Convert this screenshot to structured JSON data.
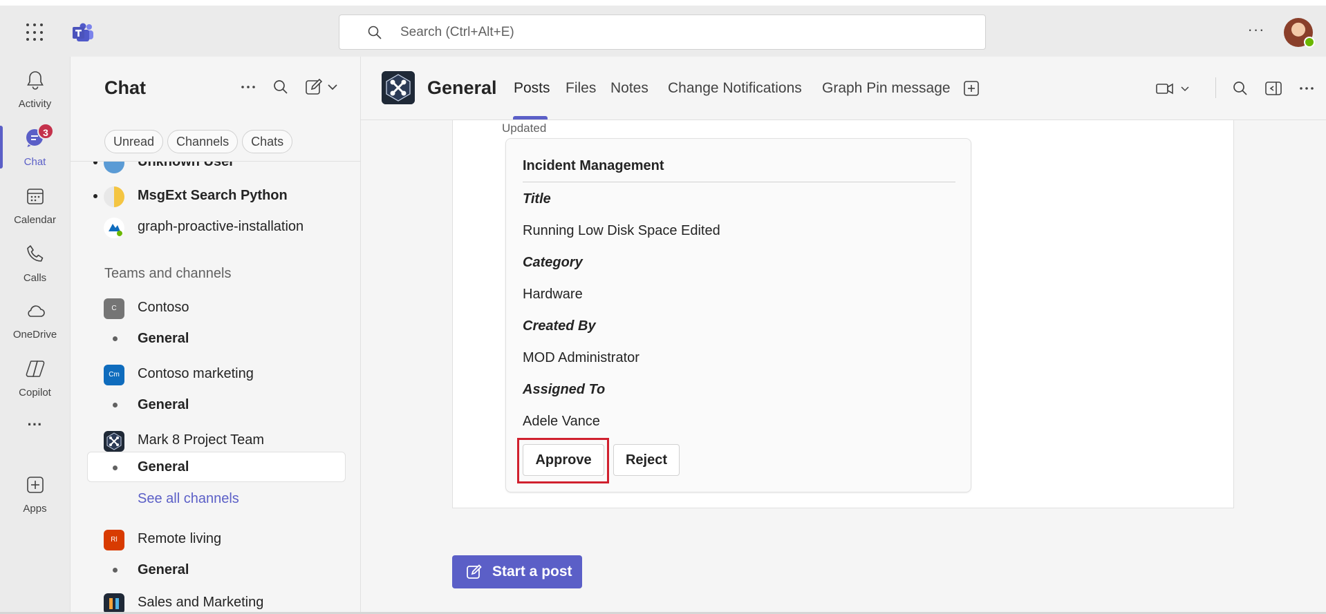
{
  "search": {
    "placeholder": "Search (Ctrl+Alt+E)"
  },
  "top": {
    "more": "···"
  },
  "rail": {
    "items": [
      {
        "label": "Activity",
        "icon": "bell-icon"
      },
      {
        "label": "Chat",
        "icon": "chat-icon",
        "badge": "3",
        "active": true
      },
      {
        "label": "Calendar",
        "icon": "calendar-icon"
      },
      {
        "label": "Calls",
        "icon": "phone-icon"
      },
      {
        "label": "OneDrive",
        "icon": "cloud-icon"
      },
      {
        "label": "Copilot",
        "icon": "copilot-icon"
      },
      {
        "label": "···",
        "icon": "more-icon"
      },
      {
        "label": "Apps",
        "icon": "add-apps-icon"
      }
    ]
  },
  "chatlist": {
    "title": "Chat",
    "filters": [
      "Unread",
      "Channels",
      "Chats"
    ],
    "chats": [
      {
        "name": "Unknown User",
        "bold": true
      },
      {
        "name": "MsgExt Search Python",
        "bold": true
      },
      {
        "name": "graph-proactive-installation",
        "bold": false
      }
    ],
    "section": "Teams and channels",
    "teams": [
      {
        "name": "Contoso",
        "initials": "C",
        "color": "#757575",
        "channel": "General"
      },
      {
        "name": "Contoso marketing",
        "initials": "Cm",
        "color": "#0f6cbd",
        "channel": "General"
      },
      {
        "name": "Mark 8 Project Team",
        "initials": "",
        "color": "#1f2937",
        "channel": "General"
      },
      {
        "name": "Remote living",
        "initials": "Rl",
        "color": "#d83b01",
        "channel": "General"
      },
      {
        "name": "Sales and Marketing",
        "initials": "",
        "color": "#1f2937"
      }
    ],
    "see_all": "See all channels"
  },
  "channel": {
    "name": "General",
    "tabs": [
      "Posts",
      "Files",
      "Notes",
      "Change Notifications",
      "Graph Pin message"
    ]
  },
  "post": {
    "status": "Updated",
    "card": {
      "title": "Incident Management",
      "fields": [
        {
          "label": "Title",
          "value": "Running Low Disk Space Edited"
        },
        {
          "label": "Category",
          "value": "Hardware"
        },
        {
          "label": "Created By",
          "value": "MOD Administrator"
        },
        {
          "label": "Assigned To",
          "value": "Adele Vance"
        }
      ],
      "approve": "Approve",
      "reject": "Reject"
    }
  },
  "compose": {
    "start_post": "Start a post"
  },
  "colors": {
    "brand": "#5b5fc7",
    "highlight": "#d0202e",
    "badge": "#c4314b"
  }
}
